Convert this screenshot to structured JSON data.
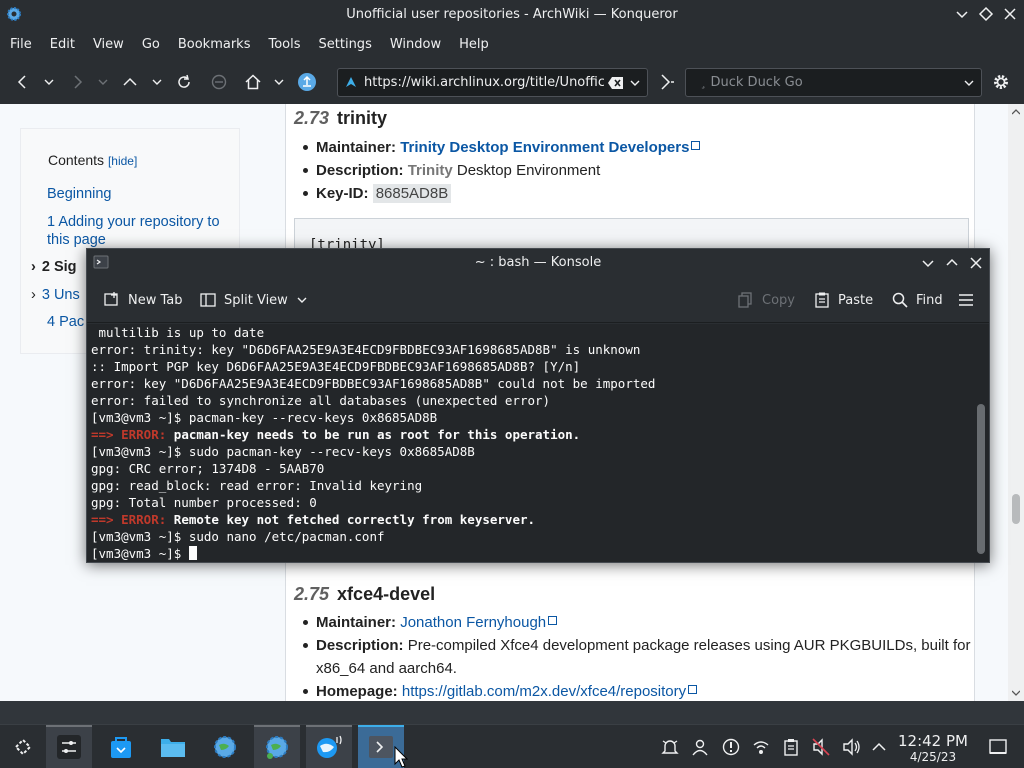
{
  "window": {
    "title": "Unofficial user repositories - ArchWiki — Konqueror",
    "menus": [
      "File",
      "Edit",
      "View",
      "Go",
      "Bookmarks",
      "Tools",
      "Settings",
      "Window",
      "Help"
    ]
  },
  "toolbar": {
    "url": "https://wiki.archlinux.org/title/Unofficial_user_repositories",
    "search_placeholder": "Duck Duck Go"
  },
  "toc": {
    "title": "Contents",
    "hide": "[hide]",
    "items": [
      {
        "label": "Beginning"
      },
      {
        "num": "1",
        "label": "Adding your repository to this page"
      },
      {
        "num": "2",
        "label": "Sig"
      },
      {
        "num": "3",
        "label": "Uns"
      },
      {
        "num": "4",
        "label": "Pac"
      }
    ]
  },
  "article": {
    "section_trinity": {
      "num": "2.73",
      "name": "trinity",
      "maintainer_label": "Maintainer:",
      "maintainer": "Trinity Desktop Environment Developers",
      "description_label": "Description:",
      "description_highlight": "Trinity",
      "description_rest": " Desktop Environment",
      "keyid_label": "Key-ID:",
      "keyid": "8685AD8B",
      "code": "[trinity]"
    },
    "section_xfce": {
      "num": "2.75",
      "name": "xfce4-devel",
      "maintainer_label": "Maintainer:",
      "maintainer": "Jonathon Fernyhough",
      "description_label": "Description:",
      "description_line1": "Pre-compiled Xfce4 development package releases using AUR PKGBUILDs, built for",
      "description_line2": "x86_64 and aarch64.",
      "homepage_label": "Homepage:",
      "homepage": "https://gitlab.com/m2x.dev/xfce4/repository"
    }
  },
  "konsole": {
    "title": "~ : bash — Konsole",
    "new_tab": "New Tab",
    "split_view": "Split View",
    "copy": "Copy",
    "paste": "Paste",
    "find": "Find",
    "lines": [
      {
        "text": " multilib is up to date"
      },
      {
        "text": "error: trinity: key \"D6D6FAA25E9A3E4ECD9FBDBEC93AF1698685AD8B\" is unknown"
      },
      {
        "text": ":: Import PGP key D6D6FAA25E9A3E4ECD9FBDBEC93AF1698685AD8B? [Y/n]"
      },
      {
        "text": "error: key \"D6D6FAA25E9A3E4ECD9FBDBEC93AF1698685AD8B\" could not be imported"
      },
      {
        "text": "error: failed to synchronize all databases (unexpected error)"
      },
      {
        "text": "[vm3@vm3 ~]$ pacman-key --recv-keys 0x8685AD8B"
      },
      {
        "prefix": "==> ERROR: ",
        "text": "pacman-key needs to be run as root for this operation."
      },
      {
        "text": "[vm3@vm3 ~]$ sudo pacman-key --recv-keys 0x8685AD8B"
      },
      {
        "text": "gpg: CRC error; 1374D8 - 5AAB70"
      },
      {
        "text": "gpg: read_block: read error: Invalid keyring"
      },
      {
        "text": "gpg: Total number processed: 0"
      },
      {
        "prefix": "==> ERROR: ",
        "text": "Remote key not fetched correctly from keyserver."
      },
      {
        "text": "[vm3@vm3 ~]$ sudo nano /etc/pacman.conf"
      },
      {
        "text": "[vm3@vm3 ~]$ "
      }
    ]
  },
  "taskbar": {
    "time": "12:42 PM",
    "date": "4/25/23"
  },
  "colors": {
    "accent": "#3daee9",
    "link": "#0b57a4",
    "error": "#c0392b",
    "panel": "#2a2e32"
  }
}
